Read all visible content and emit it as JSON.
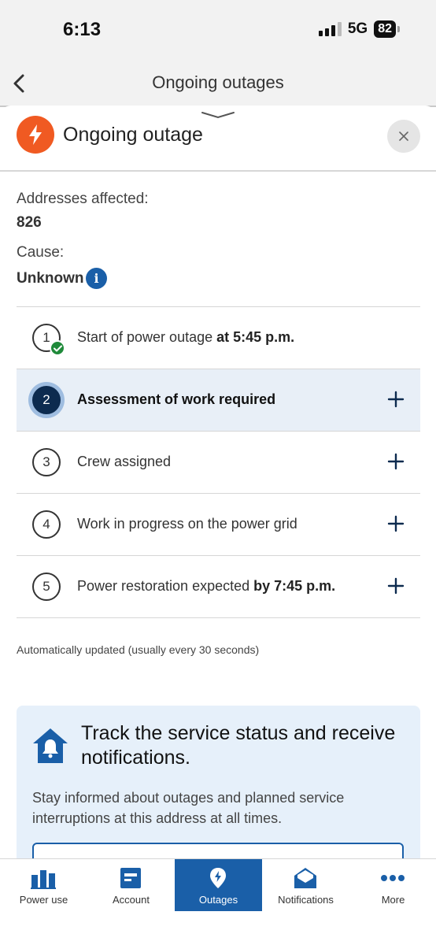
{
  "status_bar": {
    "time": "6:13",
    "network": "5G",
    "battery": "82"
  },
  "header": {
    "title": "Ongoing outages"
  },
  "sheet": {
    "title": "Ongoing outage",
    "addresses_label": "Addresses affected:",
    "addresses_value": "826",
    "cause_label": "Cause:",
    "cause_value": "Unknown",
    "info_glyph": "i"
  },
  "steps": [
    {
      "number": "1",
      "text": "Start of power outage ",
      "bold": "at 5:45 p.m.",
      "state": "completed"
    },
    {
      "number": "2",
      "text": "Assessment of work required",
      "bold": "",
      "state": "current"
    },
    {
      "number": "3",
      "text": "Crew assigned",
      "bold": "",
      "state": "pending"
    },
    {
      "number": "4",
      "text": "Work in progress on the power grid",
      "bold": "",
      "state": "pending"
    },
    {
      "number": "5",
      "text": "Power restoration expected ",
      "bold": "by 7:45 p.m.",
      "state": "pending"
    }
  ],
  "auto_update_note": "Automatically updated (usually every 30 seconds)",
  "promo": {
    "title": "Track the service status and receive notifications.",
    "text": "Stay informed about outages and planned service interruptions at this address at all times."
  },
  "tabs": [
    {
      "label": "Power use",
      "icon": "bar-chart-icon",
      "active": false
    },
    {
      "label": "Account",
      "icon": "bill-icon",
      "active": false
    },
    {
      "label": "Outages",
      "icon": "outage-pin-icon",
      "active": true
    },
    {
      "label": "Notifications",
      "icon": "envelope-icon",
      "active": false
    },
    {
      "label": "More",
      "icon": "more-dots-icon",
      "active": false
    }
  ],
  "colors": {
    "brand_blue": "#1a5fa8",
    "outage_orange": "#f05a22",
    "active_step": "#0d2b4f",
    "success_green": "#1f8a3a"
  }
}
